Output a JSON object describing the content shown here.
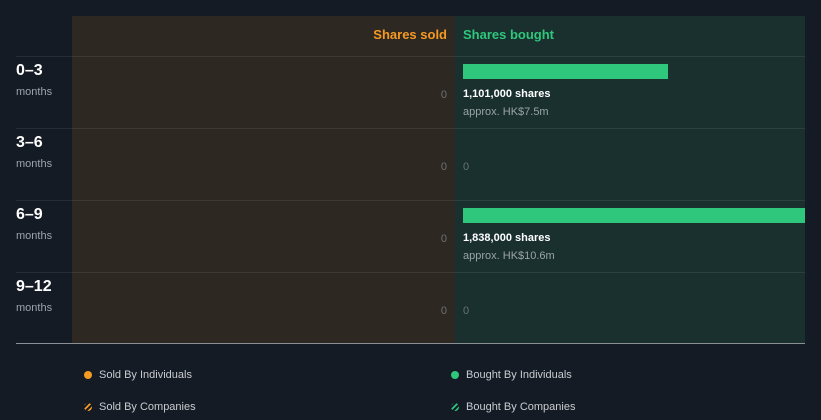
{
  "chart_data": {
    "type": "bar",
    "headers": {
      "sold": "Shares sold",
      "bought": "Shares bought"
    },
    "categories": [
      {
        "range": "0–3",
        "unit": "months"
      },
      {
        "range": "3–6",
        "unit": "months"
      },
      {
        "range": "6–9",
        "unit": "months"
      },
      {
        "range": "9–12",
        "unit": "months"
      }
    ],
    "series": [
      {
        "name": "Shares sold",
        "values": [
          0,
          0,
          0,
          0
        ]
      },
      {
        "name": "Shares bought",
        "values": [
          1101000,
          0,
          1838000,
          0
        ]
      }
    ],
    "labels": {
      "sold": [
        "0",
        "0",
        "0",
        "0"
      ],
      "bought": [
        {
          "shares": "1,101,000 shares",
          "approx": "approx. HK$7.5m"
        },
        {
          "zero": "0"
        },
        {
          "shares": "1,838,000 shares",
          "approx": "approx. HK$10.6m"
        },
        {
          "zero": "0"
        }
      ]
    },
    "xlim": [
      0,
      1838000
    ],
    "legend": [
      {
        "label": "Sold By Individuals",
        "color": "#f59a23",
        "style": "dot"
      },
      {
        "label": "Bought By Individuals",
        "color": "#2ec77b",
        "style": "dot"
      },
      {
        "label": "Sold By Companies",
        "color": "#f59a23",
        "style": "hatched"
      },
      {
        "label": "Bought By Companies",
        "color": "#2ec77b",
        "style": "hatched"
      }
    ],
    "colors": {
      "sold": "#f59a23",
      "bought": "#2ec77b",
      "sold_bg": "#2d2822",
      "bought_bg": "#19302f",
      "page_bg": "#151b24"
    }
  }
}
